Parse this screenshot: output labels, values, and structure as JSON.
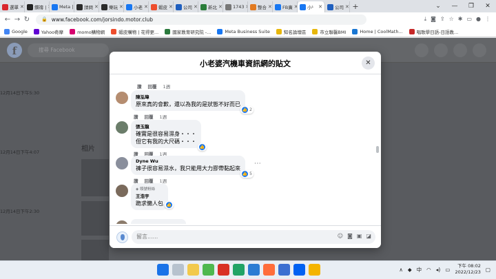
{
  "browser": {
    "tabs": [
      {
        "label": "選單",
        "color": "#d9262c"
      },
      {
        "label": "鑽禱 |",
        "color": "#222222"
      },
      {
        "label": "Meta |",
        "color": "#1877f2"
      },
      {
        "label": "請問",
        "color": "#2b2b2b"
      },
      {
        "label": "樂玩",
        "color": "#2b2b2b"
      },
      {
        "label": "小老",
        "color": "#1877f2"
      },
      {
        "label": "蝦皮",
        "color": "#ee4d2d"
      },
      {
        "label": "公司",
        "color": "#1f5fbf"
      },
      {
        "label": "新北",
        "color": "#2a7d3a"
      },
      {
        "label": "1743",
        "color": "#777777"
      },
      {
        "label": "整合",
        "color": "#e27a20"
      },
      {
        "label": "FB廣",
        "color": "#1877f2"
      },
      {
        "label": "小¹",
        "color": "#1877f2",
        "active": true
      },
      {
        "label": "公司",
        "color": "#1f5fbf"
      }
    ],
    "url": "www.facebook.com/jorsindo.motor.club",
    "bookmarks": [
      {
        "label": "Google",
        "color": "#4285f4"
      },
      {
        "label": "Yahoo奇摩",
        "color": "#6001d2"
      },
      {
        "label": "momo購物網",
        "color": "#d6006e"
      },
      {
        "label": "蝦皮購物 | 花得更...",
        "color": "#ee4d2d"
      },
      {
        "label": "國家教育研究院 -...",
        "color": "#2b7a3d"
      },
      {
        "label": "Meta Business Suite",
        "color": "#1877f2"
      },
      {
        "label": "知名論壇區",
        "color": "#e8b70c"
      },
      {
        "label": "市立聯醫BMI",
        "color": "#e8b70c"
      },
      {
        "label": "Home | CoolMath...",
        "color": "#1976d2"
      },
      {
        "label": "唱歌學日語-日語教...",
        "color": "#c62828"
      }
    ]
  },
  "fb": {
    "search_placeholder": "搜尋 Facebook",
    "timestamps": [
      "12月14日下午5:30",
      "12月14日下午4:07",
      "12月14日下午2:30"
    ],
    "photos_label": "相片"
  },
  "modal": {
    "title": "小老婆汽機車資訊網的貼文",
    "actions": {
      "like": "讚",
      "reply": "回覆",
      "age": "1週"
    },
    "comments": [
      {
        "name": "陳泓瑋",
        "badge": "",
        "text": "原來真的會歉，還以為我的是狀態不好而已",
        "likes": "2",
        "avatar": "#b58d70"
      },
      {
        "name": "張玉龍",
        "badge": "",
        "text": "確實是很容易濕身・・・\n但它有我的大尺碼・・・",
        "likes": "",
        "avatar": "#6b7d6a"
      },
      {
        "name": "Dyne Wu",
        "badge": "",
        "text": "褲子很容易濕水，我只能用大力膠帶黏起來",
        "likes": "5",
        "avatar": "#8a8f9c"
      },
      {
        "name": "王浩宇",
        "badge": "頭號粉絲",
        "text": "跪求懶人包",
        "likes": "",
        "avatar": "#7a6a5c"
      }
    ],
    "comment_placeholder": "留言......"
  },
  "taskbar": {
    "time": "下午 08:02",
    "date": "2022/12/23",
    "ime": "中"
  }
}
